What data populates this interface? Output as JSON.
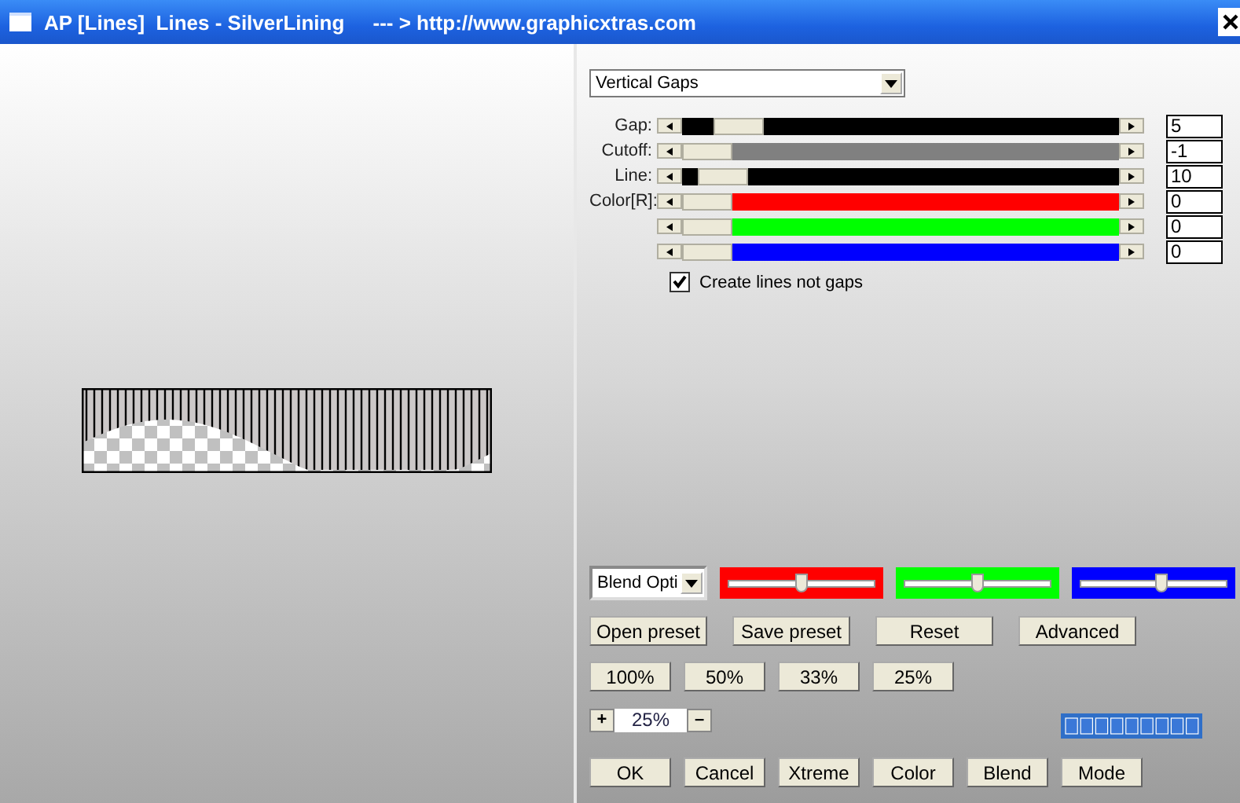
{
  "window": {
    "title": "AP [Lines]  Lines - SilverLining     --- > http://www.graphicxtras.com"
  },
  "mode_dropdown": {
    "value": "Vertical Gaps"
  },
  "sliders": [
    {
      "label": "Gap:",
      "level": 0.08,
      "value": "5",
      "color": "#000000"
    },
    {
      "label": "Cutoff:",
      "level": 0.0,
      "value": "-1",
      "color": "#808080"
    },
    {
      "label": "Line:",
      "level": 0.04,
      "value": "10",
      "color": "#000000"
    },
    {
      "label": "Color[R]:",
      "level": 0.0,
      "value": "0",
      "color": "#ff0000"
    },
    {
      "level": 0.0,
      "value": "0",
      "color": "#00ff00"
    },
    {
      "level": 0.0,
      "value": "0",
      "color": "#0000ff"
    }
  ],
  "checkbox": {
    "label": "Create lines not gaps",
    "checked": true
  },
  "blend_dropdown": {
    "value": "Blend Opti"
  },
  "blend_sliders": [
    {
      "level": 0.5,
      "color": "#ff0000"
    },
    {
      "level": 0.5,
      "color": "#00ff00"
    },
    {
      "level": 0.55,
      "color": "#0000ff"
    }
  ],
  "preset_buttons": [
    "Open preset",
    "Save preset",
    "Reset",
    "Advanced"
  ],
  "zoom_buttons": [
    "100%",
    "50%",
    "33%",
    "25%"
  ],
  "zoom": {
    "plus": "+",
    "value": "25%",
    "minus": "–"
  },
  "action_buttons": [
    "OK",
    "Cancel",
    "Xtreme",
    "Color",
    "Blend",
    "Mode"
  ]
}
